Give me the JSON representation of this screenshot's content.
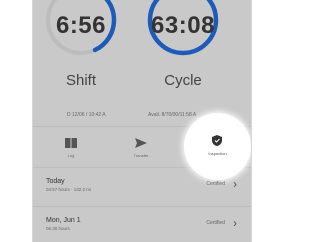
{
  "clocks": {
    "shift": {
      "value": "6:56",
      "label": "Shift"
    },
    "cycle": {
      "value": "63:08",
      "label": "Cycle"
    }
  },
  "info": {
    "left": "D 12/06 / 10:42 A",
    "right": "Avail. 8/70/00/11:58 A"
  },
  "actions": [
    {
      "icon": "log-book-icon",
      "label": "Log"
    },
    {
      "icon": "send-arrow-icon",
      "label": "Transfer"
    },
    {
      "icon": "shield-icon",
      "label": "Inspection"
    }
  ],
  "list": [
    {
      "title": "Today",
      "subtitle": "04:57 hours · 132.2 mi",
      "status": "Certified"
    },
    {
      "title": "Mon, Jun 1",
      "subtitle": "06:30 hours",
      "status": "Certified"
    }
  ],
  "colors": {
    "ring_accent": "#1e5bb8",
    "ring_track": "#bcbcbc"
  }
}
